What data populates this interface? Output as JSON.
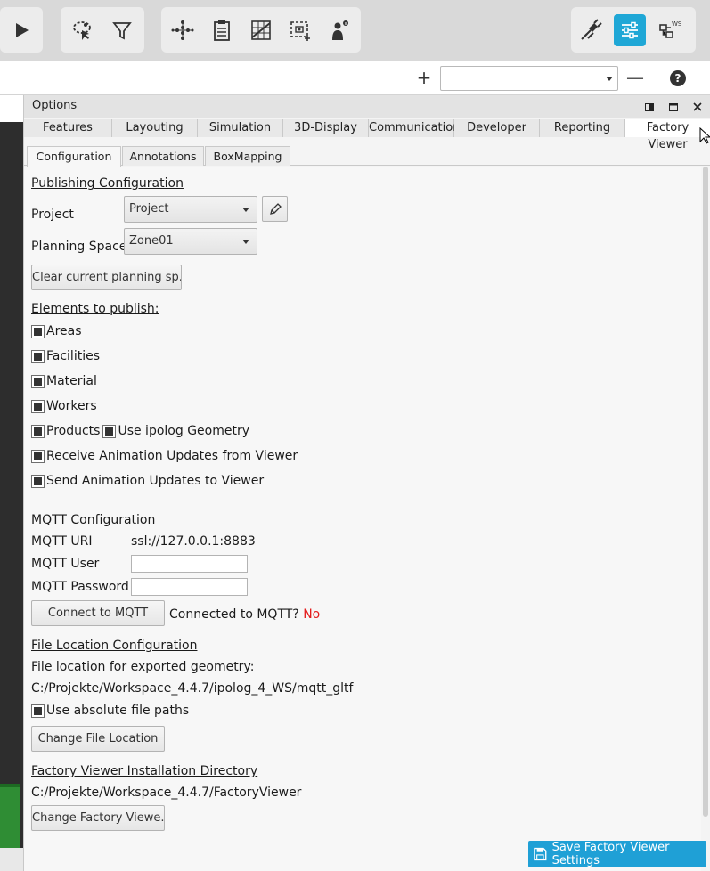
{
  "toolbar": {
    "icons": [
      "play-icon",
      "lasso-select-icon",
      "filter-icon",
      "network-icon",
      "clipboard-icon",
      "grid-chart-icon",
      "region-select-icon",
      "worker-info-icon",
      "plug-icon",
      "settings-sliders-icon",
      "ws-hierarchy-icon"
    ],
    "active": "settings-sliders-icon",
    "accent": "#1fa7d6"
  },
  "bar2": {
    "plus_label": "+",
    "minus_label": "—",
    "help_label": "?"
  },
  "options": {
    "title": "Options",
    "tabs": [
      "Features",
      "Layouting",
      "Simulation",
      "3D-Display",
      "Communication",
      "Developer",
      "Reporting",
      "Factory Viewer"
    ],
    "active_tab": "Factory Viewer",
    "subtabs": [
      "Configuration",
      "Annotations",
      "BoxMapping"
    ],
    "active_subtab": "Configuration"
  },
  "config": {
    "publishing_heading": "Publishing Configuration",
    "project_label": "Project",
    "project_value": "Project",
    "planning_space_label": "Planning Space",
    "planning_space_value": "Zone01",
    "clear_button": "Clear current planning sp...",
    "elements_heading": "Elements to publish:",
    "checkboxes": {
      "areas": "Areas",
      "facilities": "Facilities",
      "material": "Material",
      "workers": "Workers",
      "products": "Products",
      "use_ipolog_geometry": "Use ipolog Geometry",
      "receive_updates": "Receive Animation Updates from Viewer",
      "send_updates": "Send Animation Updates to Viewer"
    },
    "mqtt_heading": "MQTT Configuration",
    "mqtt_uri_label": "MQTT URI",
    "mqtt_uri_value": "ssl://127.0.0.1:8883",
    "mqtt_user_label": "MQTT User",
    "mqtt_user_value": "",
    "mqtt_password_label": "MQTT Password",
    "mqtt_password_value": "",
    "connect_button": "Connect to MQTT",
    "connected_label": "Connected to MQTT?",
    "connected_value": "No",
    "file_heading": "File Location Configuration",
    "file_location_label": "File location for exported geometry:",
    "file_location_value": "C:/Projekte/Workspace_4.4.7/ipolog_4_WS/mqtt_gltf",
    "absolute_paths": "Use absolute file paths",
    "change_file_button": "Change File Location",
    "fv_heading": "Factory Viewer Installation Directory",
    "fv_path": "C:/Projekte/Workspace_4.4.7/FactoryViewer",
    "change_fv_button": "Change Factory Viewe...",
    "save_button": "Save Factory Viewer Settings"
  }
}
